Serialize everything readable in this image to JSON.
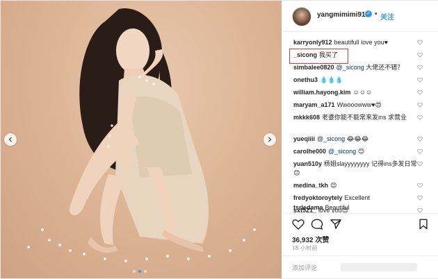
{
  "post": {
    "username": "yangmimimi912",
    "verified_symbol": "✓",
    "separator": "•",
    "follow_label": "关注",
    "likes": "36,932 次赞",
    "time": "18 小时前",
    "add_comment_placeholder": "添加评论"
  },
  "comments": [
    {
      "user": "karryonly912",
      "text": "beautifull love you♥"
    },
    {
      "user": "_sicong",
      "text": "我买了"
    },
    {
      "user": "simbalee0820",
      "mention": "@_sicong",
      "text": "大佬还不错？"
    },
    {
      "user": "onethu3",
      "text": "💧💧💧"
    },
    {
      "user": "william.hayong.kim",
      "text": "☺☺☺"
    },
    {
      "user": "maryam_a171",
      "text": "Wwooowww♥😍"
    },
    {
      "user": "mkkk608",
      "text": "老婆你能不能常来发ins 求营业"
    },
    {
      "user": "yueqiiii",
      "mention": "@_sicong",
      "text": "😂😂😂"
    },
    {
      "user": "carolhe000",
      "mention": "@_sicong",
      "text": "😊"
    },
    {
      "user": "yuan510y",
      "text": "杨姐slayyyyyyyy 记得ins多发日常😊"
    },
    {
      "user": "medina_tkh",
      "text": "😊"
    },
    {
      "user": "fredyoktoroytely",
      "text": "Excellent"
    },
    {
      "user": "sxt521_",
      "text": "love you😍"
    },
    {
      "user": "tsrledama",
      "text": "Beautiful"
    }
  ],
  "icons": {
    "like": "heart-icon",
    "comment": "comment-bubble-icon",
    "share": "share-arrow-icon",
    "save": "bookmark-icon",
    "prev": "chevron-left-icon",
    "next": "chevron-right-icon"
  },
  "colors": {
    "accent": "#3897f0",
    "highlight_box": "#ee3333",
    "photo_background": "#ddb697"
  },
  "carousel": {
    "total": 3,
    "active": 2
  }
}
